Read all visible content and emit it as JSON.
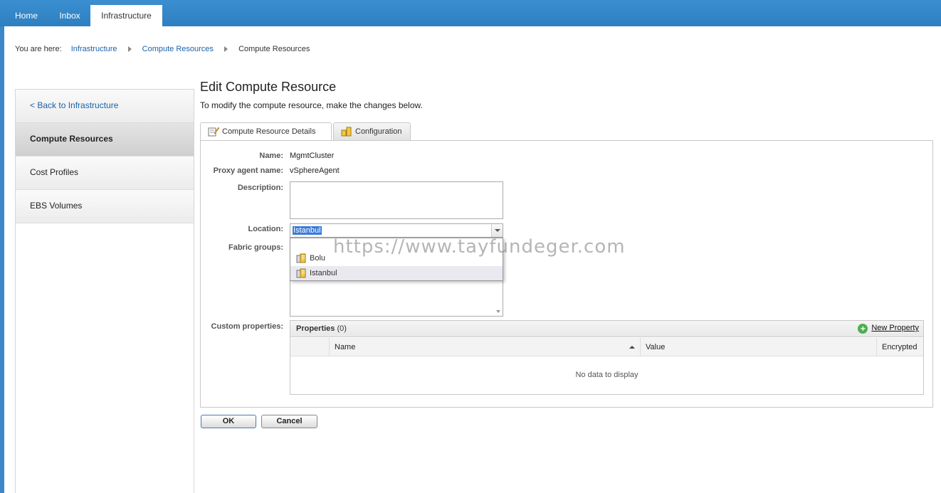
{
  "nav": {
    "tabs": [
      {
        "label": "Home"
      },
      {
        "label": "Inbox"
      },
      {
        "label": "Infrastructure"
      }
    ]
  },
  "breadcrumb": {
    "prefix": "You are here:",
    "items": [
      "Infrastructure",
      "Compute Resources",
      "Compute Resources"
    ]
  },
  "sidebar": {
    "items": [
      {
        "label": "< Back to Infrastructure"
      },
      {
        "label": "Compute Resources"
      },
      {
        "label": "Cost Profiles"
      },
      {
        "label": "EBS Volumes"
      }
    ]
  },
  "main": {
    "title": "Edit Compute Resource",
    "subtitle": "To modify the compute resource, make the changes below.",
    "tabs": [
      {
        "label": "Compute Resource Details"
      },
      {
        "label": "Configuration"
      }
    ]
  },
  "form": {
    "name_label": "Name:",
    "name_value": "MgmtCluster",
    "proxy_label": "Proxy agent name:",
    "proxy_value": "vSphereAgent",
    "description_label": "Description:",
    "location_label": "Location:",
    "location_value": "Istanbul",
    "location_options": [
      "Bolu",
      "Istanbul"
    ],
    "fabric_label": "Fabric groups:",
    "custom_label": "Custom properties:"
  },
  "properties": {
    "title": "Properties",
    "count": "(0)",
    "new_label": "New Property",
    "columns": [
      "Name",
      "Value",
      "Encrypted"
    ],
    "empty_text": "No data to display"
  },
  "buttons": {
    "ok": "OK",
    "cancel": "Cancel"
  },
  "watermark": "https://www.tayfundeger.com"
}
